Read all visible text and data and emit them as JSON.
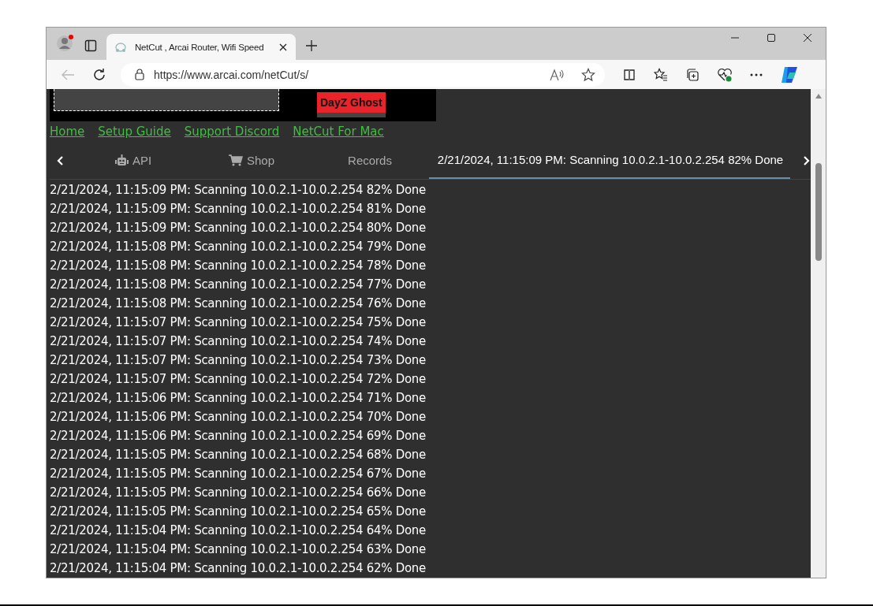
{
  "browser": {
    "tab_title": "NetCut , Arcai Router, Wifi Speed",
    "address": "https://www.arcai.com/netCut/s/"
  },
  "banner": {
    "badge": "DayZ Ghost"
  },
  "links": [
    "Home",
    "Setup Guide",
    "Support Discord",
    "NetCut For Mac"
  ],
  "tabs": [
    {
      "label": "API",
      "kind": "robot",
      "selected": false
    },
    {
      "label": "Shop",
      "kind": "cart",
      "selected": false
    },
    {
      "label": "Records",
      "kind": "plain",
      "selected": false
    },
    {
      "label": "2/21/2024, 11:15:09 PM: Scanning 10.0.2.1-10.0.2.254 82% Done",
      "kind": "plain",
      "selected": true
    }
  ],
  "log": [
    "2/21/2024, 11:15:09 PM: Scanning 10.0.2.1-10.0.2.254 82% Done",
    "2/21/2024, 11:15:09 PM: Scanning 10.0.2.1-10.0.2.254 81% Done",
    "2/21/2024, 11:15:09 PM: Scanning 10.0.2.1-10.0.2.254 80% Done",
    "2/21/2024, 11:15:08 PM: Scanning 10.0.2.1-10.0.2.254 79% Done",
    "2/21/2024, 11:15:08 PM: Scanning 10.0.2.1-10.0.2.254 78% Done",
    "2/21/2024, 11:15:08 PM: Scanning 10.0.2.1-10.0.2.254 77% Done",
    "2/21/2024, 11:15:08 PM: Scanning 10.0.2.1-10.0.2.254 76% Done",
    "2/21/2024, 11:15:07 PM: Scanning 10.0.2.1-10.0.2.254 75% Done",
    "2/21/2024, 11:15:07 PM: Scanning 10.0.2.1-10.0.2.254 74% Done",
    "2/21/2024, 11:15:07 PM: Scanning 10.0.2.1-10.0.2.254 73% Done",
    "2/21/2024, 11:15:07 PM: Scanning 10.0.2.1-10.0.2.254 72% Done",
    "2/21/2024, 11:15:06 PM: Scanning 10.0.2.1-10.0.2.254 71% Done",
    "2/21/2024, 11:15:06 PM: Scanning 10.0.2.1-10.0.2.254 70% Done",
    "2/21/2024, 11:15:06 PM: Scanning 10.0.2.1-10.0.2.254 69% Done",
    "2/21/2024, 11:15:05 PM: Scanning 10.0.2.1-10.0.2.254 68% Done",
    "2/21/2024, 11:15:05 PM: Scanning 10.0.2.1-10.0.2.254 67% Done",
    "2/21/2024, 11:15:05 PM: Scanning 10.0.2.1-10.0.2.254 66% Done",
    "2/21/2024, 11:15:05 PM: Scanning 10.0.2.1-10.0.2.254 65% Done",
    "2/21/2024, 11:15:04 PM: Scanning 10.0.2.1-10.0.2.254 64% Done",
    "2/21/2024, 11:15:04 PM: Scanning 10.0.2.1-10.0.2.254 63% Done",
    "2/21/2024, 11:15:04 PM: Scanning 10.0.2.1-10.0.2.254 62% Done"
  ]
}
